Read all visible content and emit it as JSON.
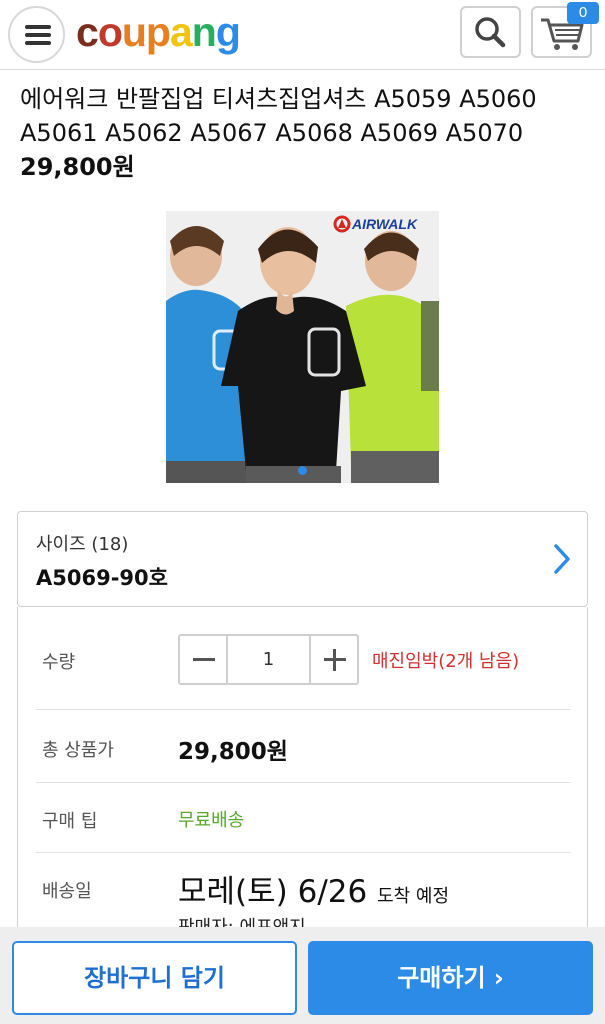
{
  "header": {
    "logo_text": "coupang",
    "logo_colors": [
      "#7b2e1e",
      "#c0392b",
      "#e67e22",
      "#f1c40f",
      "#27ae60",
      "#2c8be7",
      "#2c8be7"
    ],
    "cart_count": "0",
    "icons": [
      "menu-icon",
      "search-icon",
      "cart-icon"
    ]
  },
  "product": {
    "title": "에어워크 반팔집업 티셔츠집업셔츠 A5059 A5060 A5061 A5062 A5067 A5068 A5069 A5070",
    "price": "29,800원",
    "image_brand": "AIRWALK"
  },
  "size": {
    "label": "사이즈 (18)",
    "value": "A5069-90호"
  },
  "details": {
    "quantity_label": "수량",
    "quantity_value": "1",
    "stock_notice": "매진임박(2개 남음)",
    "total_label": "총 상품가",
    "total_value": "29,800원",
    "tip_label": "구매 팁",
    "tip_value": "무료배송",
    "delivery_label": "배송일",
    "delivery_value": "모레(토) 6/26",
    "delivery_suffix": "도착 예정",
    "seller": "판매자: 에프앤지"
  },
  "actions": {
    "add_to_cart": "장바구니 담기",
    "buy_now": "구매하기 ›"
  },
  "colors": {
    "accent": "#2c8be7",
    "stock_warning": "#d32f2f",
    "free_shipping": "#5aa52b"
  }
}
